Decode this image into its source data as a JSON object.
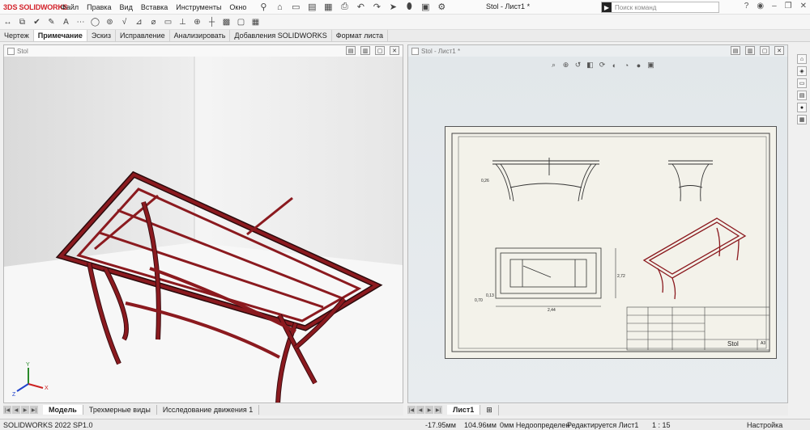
{
  "app": {
    "brand": "SOLIDWORKS",
    "brand_prefix": "3DS",
    "doc_title": "Stol - Лист1 *",
    "menus": [
      "Файл",
      "Правка",
      "Вид",
      "Вставка",
      "Инструменты",
      "Окно"
    ],
    "search_placeholder": "Поиск команд",
    "accent_color": "#d3222a"
  },
  "command_tabs": {
    "items": [
      "Чертеж",
      "Примечание",
      "Эскиз",
      "Исправление",
      "Анализировать",
      "Добавления SOLIDWORKS",
      "Формат листа"
    ],
    "active": "Примечание"
  },
  "left_pane": {
    "title": "Stol",
    "frame_color": "#8b1a1f",
    "tabs": [
      "Модель",
      "Трехмерные виды",
      "Исследование движения 1"
    ],
    "active_tab": "Модель"
  },
  "right_pane": {
    "title": "Stol - Лист1 *",
    "tabs": [
      "Лист1"
    ],
    "active_tab": "Лист1",
    "title_block_name": "Stol",
    "title_block_size": "A3",
    "dimensions": [
      "2,44",
      "0,13",
      "0,70",
      "0,26",
      "2,72"
    ]
  },
  "status_bar": {
    "version": "SOLIDWORKS 2022 SP1.0",
    "x": "-17.95мм",
    "y": "104.96мм",
    "z": "0мм Недоопределен",
    "editing": "Редактируется Лист1",
    "scale": "1 : 15",
    "settings": "Настройка"
  }
}
